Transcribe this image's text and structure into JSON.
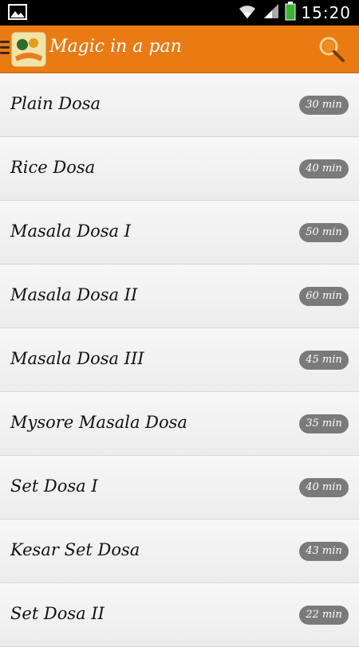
{
  "status_bar": {
    "time": "15:20",
    "icons": [
      "image-icon",
      "wifi-icon",
      "signal-icon",
      "battery-icon"
    ]
  },
  "action_bar": {
    "title": "Magic in a pan",
    "icons": [
      "menu-icon",
      "app-logo-icon",
      "search-icon"
    ],
    "colors": {
      "background": "#ea7a12",
      "title": "#ffffff"
    }
  },
  "recipes": [
    {
      "name": "Plain Dosa",
      "time": "30 min"
    },
    {
      "name": "Rice Dosa",
      "time": "40 min"
    },
    {
      "name": "Masala Dosa I",
      "time": "50 min"
    },
    {
      "name": "Masala Dosa II",
      "time": "60 min"
    },
    {
      "name": "Masala Dosa III",
      "time": "45 min"
    },
    {
      "name": "Mysore Masala Dosa",
      "time": "35 min"
    },
    {
      "name": "Set Dosa I",
      "time": "40 min"
    },
    {
      "name": "Kesar Set Dosa",
      "time": "43 min"
    },
    {
      "name": "Set Dosa II",
      "time": "22 min"
    }
  ],
  "colors": {
    "time_badge": "#7a7a7a",
    "list_background": "#f2f2f2"
  }
}
